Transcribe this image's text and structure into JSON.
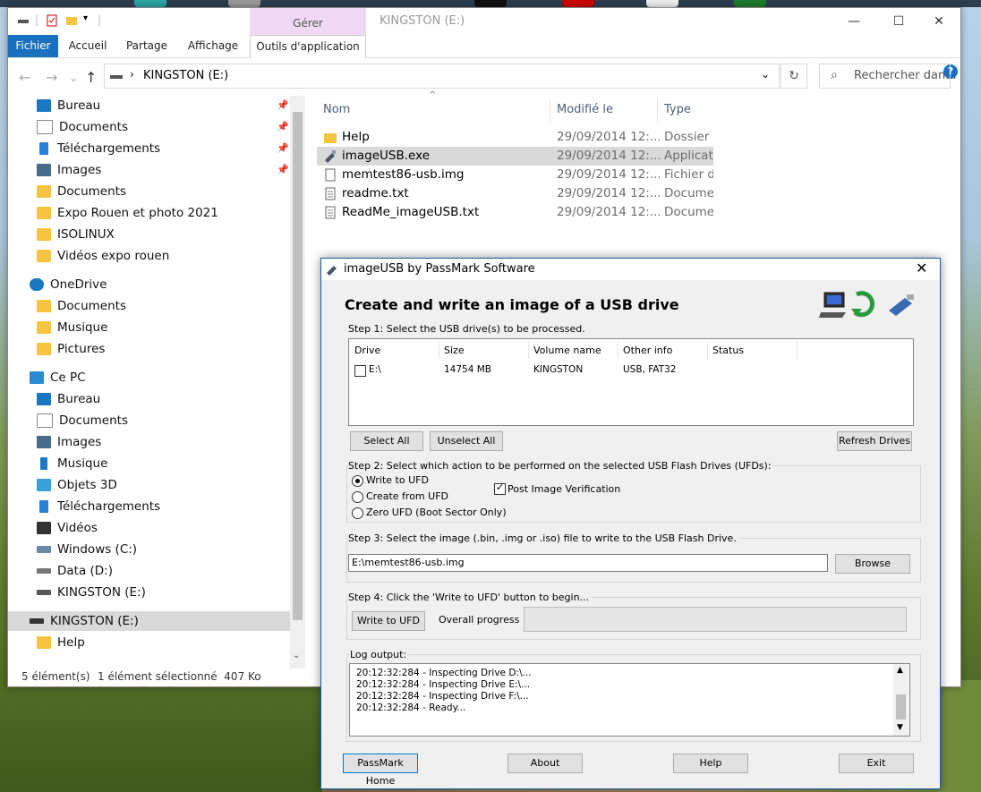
{
  "explorer": {
    "title": "KINGSTON (E:)",
    "context_tab_header": "Gérer",
    "ribbon_tabs": [
      "Fichier",
      "Accueil",
      "Partage",
      "Affichage",
      "Outils d'application"
    ],
    "address": {
      "path": "KINGSTON (E:)"
    },
    "search": {
      "placeholder": "Rechercher dan..."
    },
    "nav": {
      "quick_access": [
        "Bureau",
        "Documents",
        "Téléchargements",
        "Images",
        "Documents",
        "Expo Rouen et photo 2021",
        "ISOLINUX",
        "Vidéos expo rouen"
      ],
      "onedrive": {
        "label": "OneDrive",
        "items": [
          "Documents",
          "Musique",
          "Pictures"
        ]
      },
      "ce_pc": {
        "label": "Ce PC",
        "items": [
          "Bureau",
          "Documents",
          "Images",
          "Musique",
          "Objets 3D",
          "Téléchargements",
          "Vidéos",
          "Windows (C:)",
          "Data (D:)",
          "KINGSTON (E:)"
        ]
      },
      "kingston": {
        "label": "KINGSTON (E:)",
        "items": [
          "Help"
        ]
      }
    },
    "columns": [
      "Nom",
      "Modifié le",
      "Type"
    ],
    "files": [
      {
        "name": "Help",
        "date": "29/09/2014 12:...",
        "type": "Dossier d",
        "icon": "folder-icon"
      },
      {
        "name": "imageUSB.exe",
        "date": "29/09/2014 12:...",
        "type": "Applicatio",
        "icon": "usb-app-icon"
      },
      {
        "name": "memtest86-usb.img",
        "date": "29/09/2014 12:...",
        "type": "Fichier d'",
        "icon": "file-icon"
      },
      {
        "name": "readme.txt",
        "date": "29/09/2014 12:...",
        "type": "Documen",
        "icon": "text-file-icon"
      },
      {
        "name": "ReadMe_imageUSB.txt",
        "date": "29/09/2014 12:...",
        "type": "Documen",
        "icon": "text-file-icon"
      }
    ],
    "status": {
      "count": "5 élément(s)",
      "selection": "1 élément sélectionné  407 Ko"
    }
  },
  "imageusb": {
    "title": "imageUSB by PassMark Software",
    "heading": "Create and write an image of a USB drive",
    "step1": "Step 1: Select the USB drive(s) to be processed.",
    "columns": [
      "Drive",
      "Size",
      "Volume name",
      "Other info",
      "Status"
    ],
    "drive": {
      "drive": "E:\\",
      "size": "14754 MB",
      "volume": "KINGSTON",
      "info": "USB, FAT32",
      "status": ""
    },
    "btn_select_all": "Select All",
    "btn_unselect_all": "Unselect All",
    "btn_refresh": "Refresh Drives",
    "step2": "Step 2: Select which action to be performed on the selected USB Flash Drives (UFDs):",
    "options": [
      "Write to UFD",
      "Create from UFD",
      "Zero UFD (Boot Sector Only)"
    ],
    "verify": "Post Image Verification",
    "step3": "Step 3: Select the image (.bin, .img or .iso) file to write to the USB Flash Drive.",
    "image_path": "E:\\memtest86-usb.img",
    "btn_browse": "Browse",
    "step4": "Step 4: Click the 'Write to UFD' button to begin...",
    "btn_write": "Write to UFD",
    "progress_label": "Overall progress",
    "log_label": "Log output:",
    "log": [
      "20:12:32:284 - Inspecting Drive D:\\...",
      "20:12:32:284 - Inspecting Drive E:\\...",
      "20:12:32:284 - Inspecting Drive F:\\...",
      "20:12:32:284 - Ready..."
    ],
    "footer": [
      "PassMark Home",
      "About",
      "Help",
      "Exit"
    ]
  }
}
